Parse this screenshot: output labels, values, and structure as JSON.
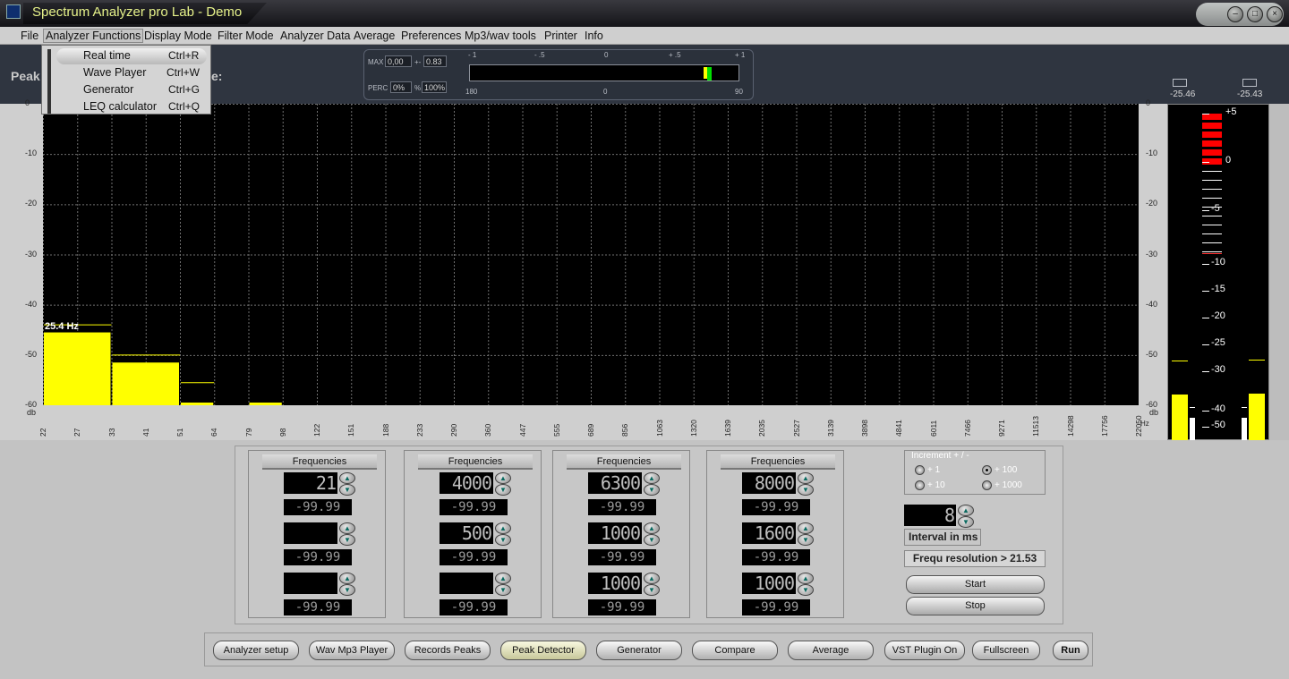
{
  "window": {
    "title": "Spectrum Analyzer pro Lab - Demo",
    "buttons": [
      "minimize",
      "maximize",
      "close"
    ]
  },
  "menu": [
    "File",
    "Analyzer Functions",
    "Display Mode",
    "Filter Mode",
    "Analyzer Data",
    "Average",
    "Preferences",
    "Mp3/wav tools",
    "Printer",
    "Info"
  ],
  "dropdown": {
    "items": [
      {
        "label": "Real time",
        "shortcut": "Ctrl+R",
        "highlighted": true
      },
      {
        "label": "Wave Player",
        "shortcut": "Ctrl+W"
      },
      {
        "label": "Generator",
        "shortcut": "Ctrl+G"
      },
      {
        "label": "LEQ calculator",
        "shortcut": "Ctrl+Q"
      }
    ]
  },
  "toppanel": {
    "peak_label": "Peak:",
    "colon_label": "e:"
  },
  "meter": {
    "max_label": "MAX",
    "max_value": "0,00",
    "pm": "+-",
    "pm_value": "0.83",
    "perc_label": "PERC",
    "perc_value": "0%",
    "pct_sign": "%",
    "perc_total": "100%",
    "scale_top": [
      "- 1",
      "- .5",
      "0",
      "+ .5",
      "+ 1"
    ],
    "scale_bottom": [
      "180",
      "0",
      "90"
    ]
  },
  "right_levels": {
    "left": "-25.46",
    "right": "-25.43"
  },
  "chart_data": {
    "type": "bar",
    "ylabel": "db",
    "xlabel": "Hz",
    "ylim": [
      -60,
      0
    ],
    "yticks": [
      "0",
      "-10",
      "-20",
      "-30",
      "-40",
      "-50",
      "-60"
    ],
    "categories": [
      "22",
      "27",
      "33",
      "41",
      "51",
      "64",
      "79",
      "98",
      "122",
      "151",
      "188",
      "233",
      "290",
      "360",
      "447",
      "555",
      "689",
      "856",
      "1063",
      "1320",
      "1639",
      "2035",
      "2527",
      "3139",
      "3898",
      "4841",
      "6011",
      "7466",
      "9271",
      "11513",
      "14298",
      "17756",
      "22050"
    ],
    "values": [
      -45.5,
      -51.5,
      -60,
      -60.5
    ],
    "peak_holds": [
      -44,
      -50,
      -55.5
    ],
    "bar_ranges": [
      [
        "22",
        "33"
      ],
      [
        "33",
        "51"
      ],
      [
        "51",
        "64"
      ],
      [
        "79",
        "98"
      ]
    ],
    "peak_label": "25.4 Hz",
    "grid": true,
    "bar_color": "#ffff00"
  },
  "vu_scale": [
    "+5",
    "0",
    "-5",
    "-10",
    "-15",
    "-20",
    "-25",
    "-30",
    "-40",
    "-50"
  ],
  "freq_groups": [
    {
      "header": "Frequencies",
      "values": [
        "21",
        "",
        ""
      ],
      "readouts": [
        "-99.99",
        "-99.99",
        "-99.99"
      ]
    },
    {
      "header": "Frequencies",
      "values": [
        "4000",
        "500",
        ""
      ],
      "readouts": [
        "-99.99",
        "-99.99",
        "-99.99"
      ]
    },
    {
      "header": "Frequencies",
      "values": [
        "6300",
        "1000",
        "1000"
      ],
      "readouts": [
        "-99.99",
        "-99.99",
        "-99.99"
      ]
    },
    {
      "header": "Frequencies",
      "values": [
        "8000",
        "1600",
        "1000"
      ],
      "readouts": [
        "-99.99",
        "-99.99",
        "-99.99"
      ]
    }
  ],
  "increment": {
    "title": "Increment + / -",
    "options": [
      "+ 1",
      "+ 10",
      "+ 100",
      "+ 1000"
    ],
    "selected": "+ 100"
  },
  "interval": {
    "label": "Interval in ms",
    "value": "8"
  },
  "resolution": {
    "label": "Frequ resolution > 21.53"
  },
  "controls": {
    "start": "Start",
    "stop": "Stop"
  },
  "bottom_buttons": [
    "Analyzer setup",
    "Wav Mp3 Player",
    "Records Peaks",
    "Peak Detector",
    "Generator",
    "Compare",
    "Average",
    "VST Plugin On",
    "Fullscreen",
    "Run"
  ]
}
